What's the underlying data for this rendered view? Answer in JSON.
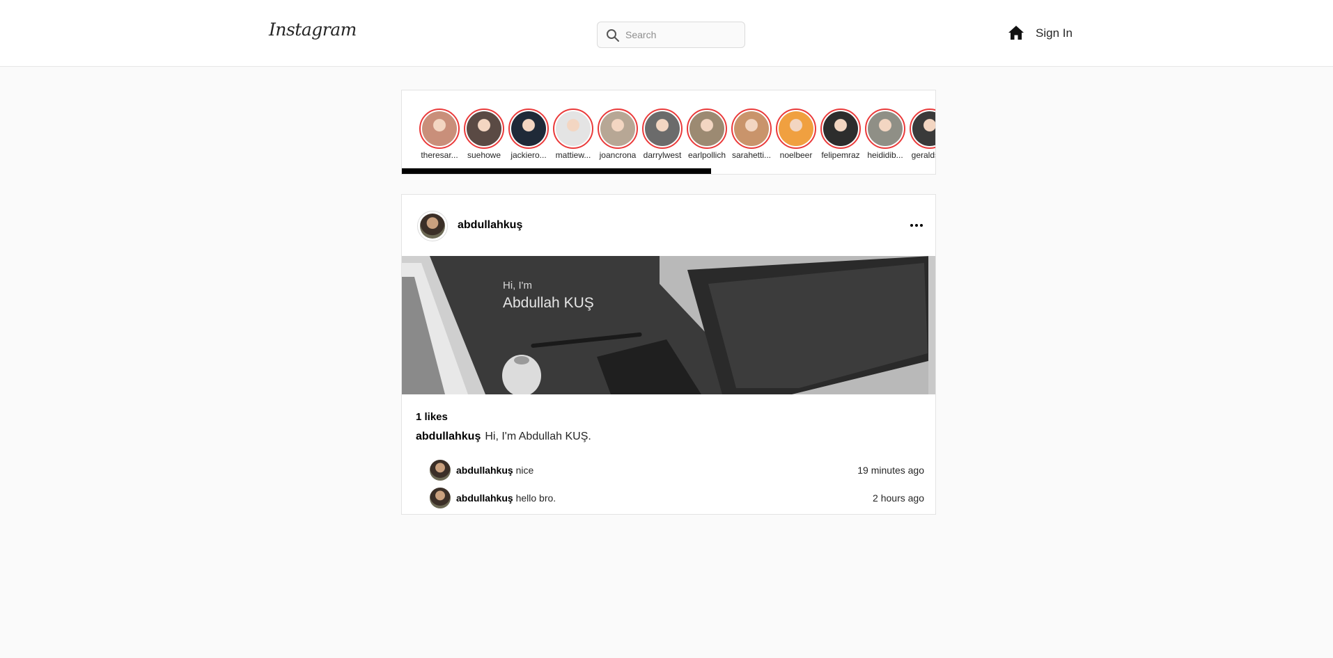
{
  "header": {
    "logo": "Instagram",
    "search_placeholder": "Search",
    "signin_label": "Sign In"
  },
  "stories": [
    {
      "username": "theresar...",
      "color": "#c98f7a"
    },
    {
      "username": "suehowe",
      "color": "#5a4a44"
    },
    {
      "username": "jackiero...",
      "color": "#1f2a38"
    },
    {
      "username": "mattiew...",
      "color": "#e4e4e4"
    },
    {
      "username": "joancrona",
      "color": "#b7a795"
    },
    {
      "username": "darrylwest",
      "color": "#6b6b6b"
    },
    {
      "username": "earlpollich",
      "color": "#9c8a72"
    },
    {
      "username": "sarahetti...",
      "color": "#c9946b"
    },
    {
      "username": "noelbeer",
      "color": "#f0a040"
    },
    {
      "username": "felipemraz",
      "color": "#2d2d2d"
    },
    {
      "username": "heididib...",
      "color": "#8f8f86"
    },
    {
      "username": "geraldst...",
      "color": "#3a3a3a"
    }
  ],
  "stories_scroll": {
    "position": 0.58
  },
  "post": {
    "username": "abdullahkuş",
    "image_greeting": "Hi, I'm",
    "image_name": "Abdullah KUŞ",
    "likes": "1 likes",
    "caption_user": "abdullahkuş",
    "caption_text": "Hi, I'm Abdullah KUŞ.",
    "comments": [
      {
        "user": "abdullahkuş",
        "text": "nice",
        "time": "19 minutes ago"
      },
      {
        "user": "abdullahkuş",
        "text": "hello bro.",
        "time": "2 hours ago"
      }
    ]
  }
}
